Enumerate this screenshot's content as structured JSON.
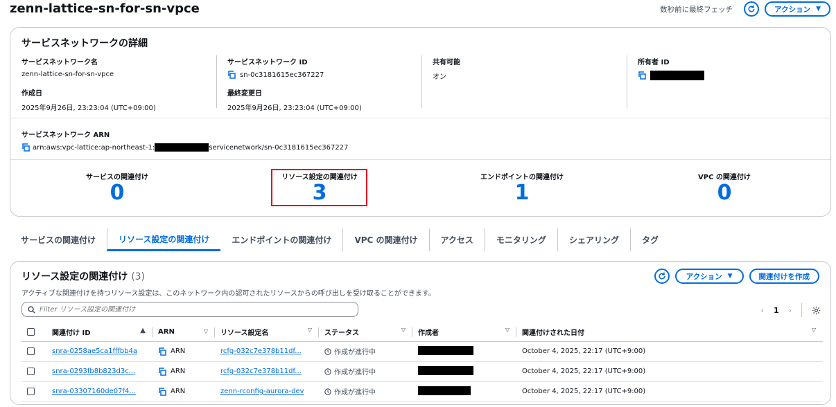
{
  "header": {
    "title": "zenn-lattice-sn-for-sn-vpce",
    "fetch_text": "数秒前に最終フェッチ",
    "action_label": "アクション"
  },
  "details": {
    "title": "サービスネットワークの詳細",
    "name_label": "サービスネットワーク名",
    "name_value": "zenn-lattice-sn-for-sn-vpce",
    "id_label": "サービスネットワーク ID",
    "id_value": "sn-0c3181615ec367227",
    "shareable_label": "共有可能",
    "shareable_value": "オン",
    "owner_label": "所有者 ID",
    "created_label": "作成日",
    "created_value": "2025年9月26日, 23:23:04 (UTC+09:00)",
    "modified_label": "最終変更日",
    "modified_value": "2025年9月26日, 23:23:04 (UTC+09:00)",
    "arn_label": "サービスネットワーク ARN",
    "arn_prefix": "arn:aws:vpc-lattice:ap-northeast-1:",
    "arn_suffix": "servicenetwork/sn-0c3181615ec367227"
  },
  "metrics": [
    {
      "label": "サービスの関連付け",
      "value": "0"
    },
    {
      "label": "リソース設定の関連付け",
      "value": "3"
    },
    {
      "label": "エンドポイントの関連付け",
      "value": "1"
    },
    {
      "label": "VPC の関連付け",
      "value": "0"
    }
  ],
  "tabs": [
    {
      "label": "サービスの関連付け"
    },
    {
      "label": "リソース設定の関連付け"
    },
    {
      "label": "エンドポイントの関連付け"
    },
    {
      "label": "VPC の関連付け"
    },
    {
      "label": "アクセス"
    },
    {
      "label": "モニタリング"
    },
    {
      "label": "シェアリング"
    },
    {
      "label": "タグ"
    }
  ],
  "list": {
    "title": "リソース設定の関連付け",
    "count": "(3)",
    "description": "アクティブな関連付けを持つリソース設定は、このネットワーク内の認可されたリソースからの呼び出しを受け取ることができます。",
    "action_label": "アクション",
    "create_label": "関連付けを作成",
    "filter_placeholder": "Filter リソース設定の関連付け",
    "page": "1",
    "columns": [
      "関連付け ID",
      "ARN",
      "リソース設定名",
      "ステータス",
      "作成者",
      "関連付けされた日付"
    ],
    "rows": [
      {
        "id": "snra-0258ae5ca1fffbb4a",
        "arn": "ARN",
        "config": "rcfg-032c7e378b11df...",
        "status": "作成が進行中",
        "date": "October 4, 2025, 22:17 (UTC+9:00)"
      },
      {
        "id": "snra-0293fb8b823d3c...",
        "arn": "ARN",
        "config": "rcfg-032c7e378b11df...",
        "status": "作成が進行中",
        "date": "October 4, 2025, 22:17 (UTC+9:00)"
      },
      {
        "id": "snra-03307160de07f4...",
        "arn": "ARN",
        "config": "zenn-rconfig-aurora-dev",
        "status": "作成が進行中",
        "date": "October 4, 2025, 22:17 (UTC+9:00)"
      }
    ]
  },
  "colors": {
    "accent": "#006ce0",
    "highlight": "#e0141e",
    "text": "#0f141a"
  }
}
